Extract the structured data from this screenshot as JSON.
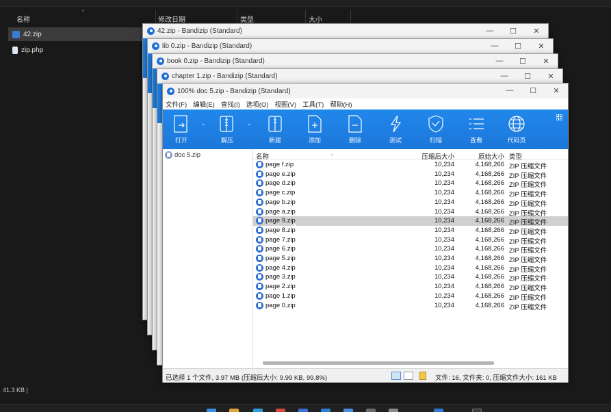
{
  "explorer": {
    "columns": {
      "name": "名称",
      "modified": "修改日期",
      "type": "类型",
      "size": "大小"
    },
    "files": [
      {
        "name": "42.zip",
        "selected": true
      },
      {
        "name": "zip.php",
        "selected": false
      }
    ],
    "status": "41.3 KB  |"
  },
  "stacked_windows": [
    {
      "title": "42.zip - Bandizip (Standard)"
    },
    {
      "title": "lib 0.zip - Bandizip (Standard)"
    },
    {
      "title": "book 0.zip - Bandizip (Standard)"
    },
    {
      "title": "chapter 1.zip - Bandizip (Standard)"
    }
  ],
  "window_controls": {
    "minimize": "—",
    "maximize": "☐",
    "close": "✕"
  },
  "main": {
    "title": "100% doc 5.zip - Bandizip (Standard)",
    "menu": [
      "文件(F)",
      "编辑(E)",
      "查找(I)",
      "选项(O)",
      "视图(V)",
      "工具(T)",
      "帮助(H)"
    ],
    "toolbar": [
      {
        "label": "打开",
        "icon": "open-icon"
      },
      {
        "label": "解压",
        "icon": "extract-icon"
      },
      {
        "label": "新建",
        "icon": "new-archive-icon"
      },
      {
        "label": "添加",
        "icon": "add-icon"
      },
      {
        "label": "删除",
        "icon": "delete-icon"
      },
      {
        "label": "测试",
        "icon": "test-icon"
      },
      {
        "label": "扫描",
        "icon": "scan-icon"
      },
      {
        "label": "查看",
        "icon": "view-icon"
      },
      {
        "label": "代码页",
        "icon": "codepage-icon"
      }
    ],
    "tree": {
      "root": "doc 5.zip"
    },
    "list": {
      "headers": {
        "name": "名称",
        "packed": "压缩后大小",
        "original": "原始大小",
        "type": "类型"
      },
      "rows": [
        {
          "name": "page f.zip",
          "packed": "10,234",
          "original": "4,168,266",
          "type": "ZIP 压缩文件",
          "selected": false
        },
        {
          "name": "page e.zip",
          "packed": "10,234",
          "original": "4,168,266",
          "type": "ZIP 压缩文件",
          "selected": false
        },
        {
          "name": "page d.zip",
          "packed": "10,234",
          "original": "4,168,266",
          "type": "ZIP 压缩文件",
          "selected": false
        },
        {
          "name": "page c.zip",
          "packed": "10,234",
          "original": "4,168,266",
          "type": "ZIP 压缩文件",
          "selected": false
        },
        {
          "name": "page b.zip",
          "packed": "10,234",
          "original": "4,168,266",
          "type": "ZIP 压缩文件",
          "selected": false
        },
        {
          "name": "page a.zip",
          "packed": "10,234",
          "original": "4,168,266",
          "type": "ZIP 压缩文件",
          "selected": false
        },
        {
          "name": "page 9.zip",
          "packed": "10,234",
          "original": "4,168,266",
          "type": "ZIP 压缩文件",
          "selected": true
        },
        {
          "name": "page 8.zip",
          "packed": "10,234",
          "original": "4,168,266",
          "type": "ZIP 压缩文件",
          "selected": false
        },
        {
          "name": "page 7.zip",
          "packed": "10,234",
          "original": "4,168,266",
          "type": "ZIP 压缩文件",
          "selected": false
        },
        {
          "name": "page 6.zip",
          "packed": "10,234",
          "original": "4,168,266",
          "type": "ZIP 压缩文件",
          "selected": false
        },
        {
          "name": "page 5.zip",
          "packed": "10,234",
          "original": "4,168,266",
          "type": "ZIP 压缩文件",
          "selected": false
        },
        {
          "name": "page 4.zip",
          "packed": "10,234",
          "original": "4,168,266",
          "type": "ZIP 压缩文件",
          "selected": false
        },
        {
          "name": "page 3.zip",
          "packed": "10,234",
          "original": "4,168,266",
          "type": "ZIP 压缩文件",
          "selected": false
        },
        {
          "name": "page 2.zip",
          "packed": "10,234",
          "original": "4,168,266",
          "type": "ZIP 压缩文件",
          "selected": false
        },
        {
          "name": "page 1.zip",
          "packed": "10,234",
          "original": "4,168,266",
          "type": "ZIP 压缩文件",
          "selected": false
        },
        {
          "name": "page 0.zip",
          "packed": "10,234",
          "original": "4,168,266",
          "type": "ZIP 压缩文件",
          "selected": false
        }
      ]
    },
    "status": {
      "selection": "已选择 1 个文件, 3.97 MB (压缩后大小: 9.99 KB, 99.8%)",
      "summary": "文件: 16, 文件夹: 0, 压缩文件大小: 161 KB"
    }
  },
  "colors": {
    "toolbar_blue": "#1e7fe0",
    "selection_grey": "#d0d0d0",
    "explorer_bg": "#191919"
  }
}
